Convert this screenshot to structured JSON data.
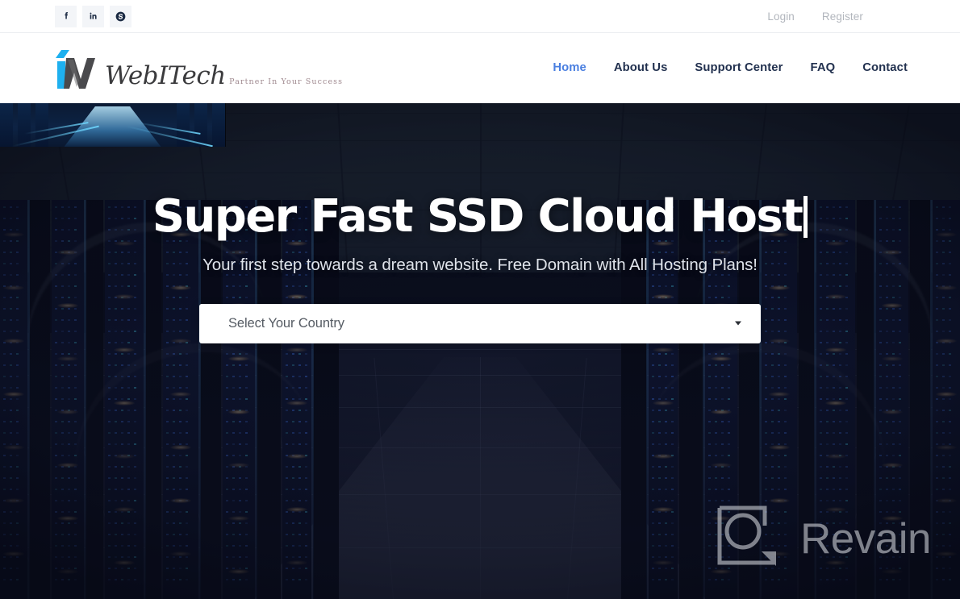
{
  "topbar": {
    "social": [
      {
        "name": "facebook-icon",
        "label": "Facebook"
      },
      {
        "name": "linkedin-icon",
        "label": "LinkedIn"
      },
      {
        "name": "skype-icon",
        "label": "Skype"
      }
    ],
    "login_label": "Login",
    "register_label": "Register"
  },
  "header": {
    "logo": {
      "word": "WebITech",
      "tagline": "Partner In Your Success",
      "mark_accent_color": "#1eb0ef",
      "mark_dark_color": "#4a4a4d"
    },
    "nav": [
      {
        "label": "Home",
        "active": true
      },
      {
        "label": "About Us",
        "active": false
      },
      {
        "label": "Support Center",
        "active": false
      },
      {
        "label": "FAQ",
        "active": false
      },
      {
        "label": "Contact",
        "active": false
      }
    ],
    "active_color": "#4a7fe0",
    "nav_color": "#22314f"
  },
  "hero": {
    "title": "Super Fast SSD Cloud Host",
    "title_has_cursor": true,
    "subtitle": "Your first step towards a dream website. Free Domain with All Hosting Plans!",
    "country_select": {
      "value": "",
      "placeholder": "Select Your Country",
      "caret_icon": "chevron-down-icon"
    },
    "background_description": "Dark data center corridor with blue-lit server racks",
    "watermark": {
      "text": "Revain",
      "logo_icon": "revain-logo-icon",
      "color": "#c9ccd2"
    }
  }
}
